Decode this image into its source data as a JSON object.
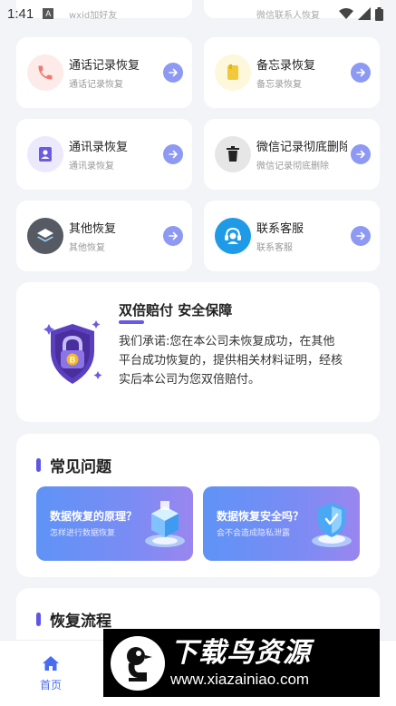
{
  "status_bar": {
    "time": "1:41",
    "notification_glyph": "A"
  },
  "top_cards_partial": {
    "left_subtitle": "wxid加好友",
    "right_subtitle": "微信联系人恢复"
  },
  "feature_cards": [
    {
      "title": "通话记录恢复",
      "subtitle": "通话记录恢复",
      "icon": "phone-icon",
      "icon_bg": "#fdebea",
      "icon_color": "#f07a72"
    },
    {
      "title": "备忘录恢复",
      "subtitle": "备忘录恢复",
      "icon": "memo-icon",
      "icon_bg": "#fdf7dc",
      "icon_color": "#f2c93a"
    },
    {
      "title": "通讯录恢复",
      "subtitle": "通讯录恢复",
      "icon": "contacts-icon",
      "icon_bg": "#ece9fc",
      "icon_color": "#6b5be2"
    },
    {
      "title": "微信记录彻底删除",
      "subtitle": "微信记录彻底删除",
      "icon": "trash-icon",
      "icon_bg": "#e6e6e6",
      "icon_color": "#222222"
    },
    {
      "title": "其他恢复",
      "subtitle": "其他恢复",
      "icon": "layers-icon",
      "icon_bg": "#555a63",
      "icon_color": "#ffffff"
    },
    {
      "title": "联系客服",
      "subtitle": "联系客服",
      "icon": "customer-service-icon",
      "icon_bg": "#1e9ae6",
      "icon_color": "#ffffff"
    }
  ],
  "guarantee": {
    "title": "双倍赔付 安全保障",
    "text": "我们承诺:您在本公司未恢复成功，在其他平台成功恢复的，提供相关材料证明，经核实后本公司为您双倍赔付。"
  },
  "faq": {
    "title": "常见问题",
    "items": [
      {
        "title": "数据恢复的原理？",
        "subtitle": "怎样进行数据恢复"
      },
      {
        "title": "数据恢复安全吗？",
        "subtitle": "会不会造成隐私泄露"
      }
    ]
  },
  "flow": {
    "title": "恢复流程"
  },
  "tabbar": {
    "home_label": "首页"
  },
  "watermark": {
    "title": "下载鸟资源",
    "url": "www.xiazainiao.com"
  },
  "colors": {
    "accent": "#5e56e6",
    "arrow_button": "#8d99f2",
    "tab_active": "#4a6cf0"
  }
}
